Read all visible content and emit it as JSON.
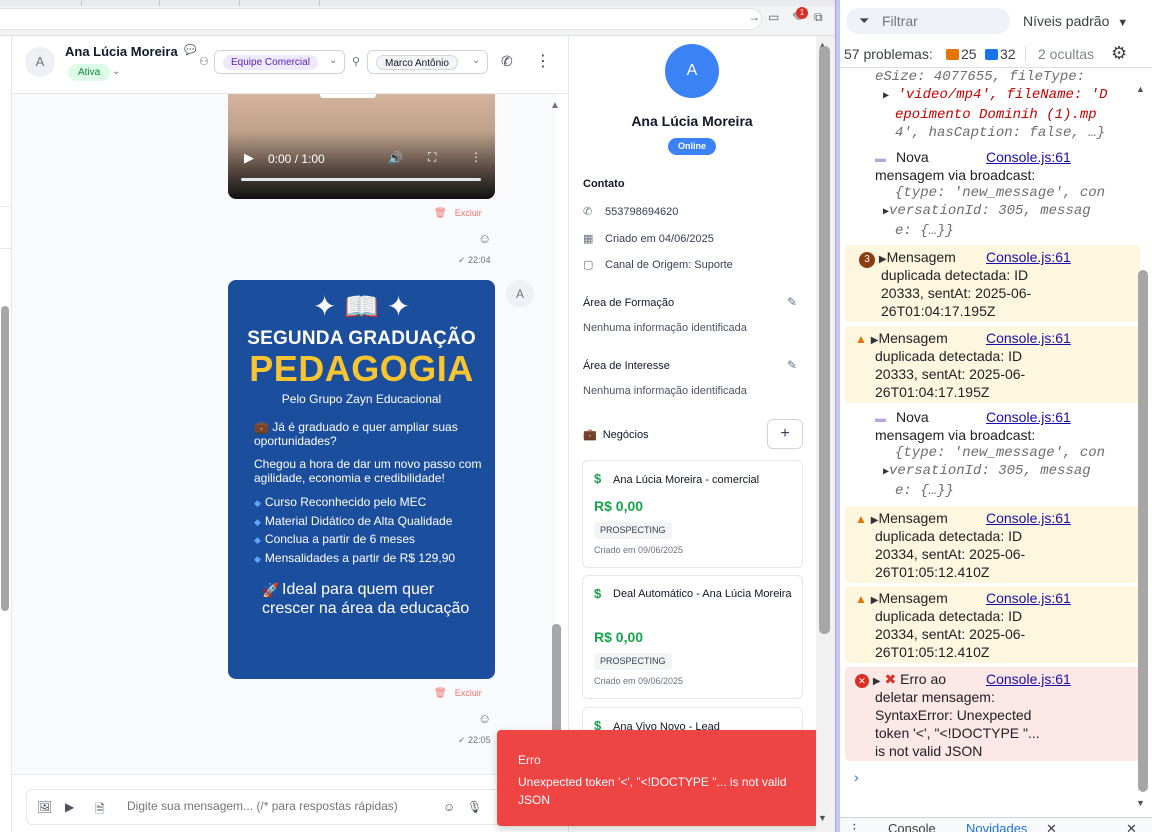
{
  "browser": {
    "badge_count": "1"
  },
  "chat": {
    "contact_initial": "A",
    "contact_name": "Ana Lúcia Moreira",
    "status": "Ativa",
    "team": "Equipe Comercial",
    "agent": "Marco Antônio"
  },
  "messages": {
    "video": {
      "time": "0:00 / 1:00",
      "delete_label": "Excluir",
      "timestamp": "22:04"
    },
    "image": {
      "sender_initial": "A",
      "heading_1": "SEGUNDA GRADUAÇÃO",
      "heading_2": "PEDAGOGIA",
      "subheading": "Pelo Grupo Zayn Educacional",
      "paragraph_1": "💼 Já é graduado e quer ampliar suas oportunidades?",
      "paragraph_2": "Chegou a hora de dar um novo passo com agilidade, economia e credibilidade!",
      "bullets": [
        "Curso Reconhecido pelo MEC",
        "Material Didático de Alta Qualidade",
        "Conclua a partir de 6 meses",
        "Mensalidades a partir de R$ 129,90"
      ],
      "cta": "Ideal para quem quer crescer na área da educação",
      "delete_label": "Excluir",
      "timestamp": "22:05"
    }
  },
  "composer": {
    "placeholder": "Digite sua mensagem... (/* para respostas rápidas)"
  },
  "contact_panel": {
    "initial": "A",
    "name": "Ana Lúcia Moreira",
    "presence": "Online",
    "contact_title": "Contato",
    "phone": "553798694620",
    "created": "Criado em 04/06/2025",
    "origin": "Canal de Origem: Suporte",
    "education_title": "Área de Formação",
    "education_value": "Nenhuma informação identificada",
    "interest_title": "Área de Interesse",
    "interest_value": "Nenhuma informação identificada",
    "deals_title": "Negócios",
    "deals": [
      {
        "title": "Ana Lúcia Moreira - comercial",
        "amount": "R$ 0,00",
        "stage": "PROSPECTING",
        "created": "Criado em 09/06/2025"
      },
      {
        "title": "Deal Automático - Ana Lúcia Moreira",
        "amount": "R$ 0,00",
        "stage": "PROSPECTING",
        "created": "Criado em 09/06/2025"
      },
      {
        "title": "Ana Vivo Novo - Lead"
      }
    ]
  },
  "toast": {
    "title": "Erro",
    "message": "Unexpected token '<', \"<!DOCTYPE \"... is not valid JSON"
  },
  "devtools": {
    "filter_placeholder": "Filtrar",
    "levels": "Níveis padrão",
    "issues_label": "57 problemas:",
    "warn_count": "25",
    "info_count": "32",
    "hidden": "2 ocultas",
    "source": "Console.js:61",
    "entry0": {
      "line1": "eSize: 4077655, fileType:",
      "line2": "'video/mp4', fileName: 'D",
      "line3": "epoimento Dominih (1).mp",
      "line4": "4', hasCaption: false, …}"
    },
    "entry1": {
      "line1": "Nova",
      "line2": "mensagem via broadcast:",
      "line3": "{type: 'new_message', con",
      "line4": "versationId: 305, messag",
      "line5": "e: {…}}"
    },
    "entry2": {
      "count": "3",
      "line1": "Mensagem",
      "line2": "duplicada detectada: ID",
      "line3": "20333, sentAt: 2025-06-",
      "line4": "26T01:04:17.195Z"
    },
    "entry3": {
      "line1": "Mensagem",
      "line2": "duplicada detectada: ID",
      "line3": "20333, sentAt: 2025-06-",
      "line4": "26T01:04:17.195Z"
    },
    "entry4": {
      "line1": "Nova",
      "line2": "mensagem via broadcast:",
      "line3": "{type: 'new_message', con",
      "line4": "versationId: 305, messag",
      "line5": "e: {…}}"
    },
    "entry5": {
      "line1": "Mensagem",
      "line2": "duplicada detectada: ID",
      "line3": "20334, sentAt: 2025-06-",
      "line4": "26T01:05:12.410Z"
    },
    "entry6": {
      "line1": "Mensagem",
      "line2": "duplicada detectada: ID",
      "line3": "20334, sentAt: 2025-06-",
      "line4": "26T01:05:12.410Z"
    },
    "entry7": {
      "line1": "Erro ao",
      "line2": "deletar mensagem:",
      "line3": "SyntaxError: Unexpected",
      "line4": "token '<', \"<!DOCTYPE \"...",
      "line5": "is not valid JSON"
    },
    "drawer_tab_1": "Console",
    "drawer_tab_2": "Novidades"
  },
  "colors": {
    "accent_blue": "#3b82f6",
    "toast_red": "#ef4444",
    "money_green": "#16a34a",
    "promo_blue": "#1b4e9c",
    "promo_yellow": "#f8c531"
  }
}
